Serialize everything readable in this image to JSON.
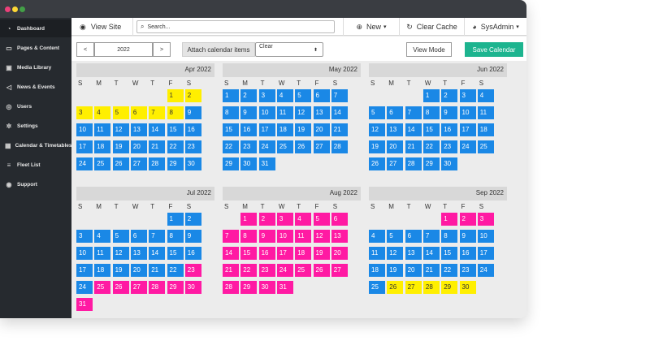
{
  "window": {
    "title_dots": [
      "#ec407a",
      "#fdd835",
      "#43a047"
    ]
  },
  "sidebar": {
    "items": [
      {
        "label": "Dashboard",
        "icon": "dashboard-icon",
        "glyph": "◔",
        "active": true
      },
      {
        "label": "Pages & Content",
        "icon": "monitor-icon",
        "glyph": "▭"
      },
      {
        "label": "Media Library",
        "icon": "image-icon",
        "glyph": "▣"
      },
      {
        "label": "News & Events",
        "icon": "megaphone-icon",
        "glyph": "◁"
      },
      {
        "label": "Users",
        "icon": "users-icon",
        "glyph": "◎"
      },
      {
        "label": "Settings",
        "icon": "gears-icon",
        "glyph": "✲"
      },
      {
        "label": "Calendar & Timetables",
        "icon": "calendar-icon",
        "glyph": "▦"
      },
      {
        "label": "Fleet List",
        "icon": "list-icon",
        "glyph": "≡"
      },
      {
        "label": "Support",
        "icon": "lifebuoy-icon",
        "glyph": "◉"
      }
    ]
  },
  "topbar": {
    "view_site_label": "View Site",
    "view_site_icon": "eye-icon",
    "search_placeholder": "Search...",
    "search_icon": "search-icon",
    "new_label": "New",
    "new_icon": "plus-circle-icon",
    "clear_cache_label": "Clear Cache",
    "clear_cache_icon": "refresh-icon",
    "user_label": "SysAdmin",
    "user_icon": "user-icon"
  },
  "toolbar": {
    "prev_label": "<",
    "year": "2022",
    "next_label": ">",
    "attach_label": "Attach calendar items",
    "select_value": "Clear",
    "view_mode_label": "View Mode",
    "save_label": "Save Calendar"
  },
  "colors": {
    "blue": "#1a88e6",
    "yellow": "#ffef00",
    "pink": "#ff1aa3",
    "accent": "#1db48f"
  },
  "calendar": {
    "weekdays": [
      "S",
      "M",
      "T",
      "W",
      "T",
      "F",
      "S"
    ],
    "months": [
      {
        "label": "Apr 2022",
        "start": 5,
        "days": 30,
        "ranges": [
          [
            "yellow",
            1,
            8
          ],
          [
            "blue",
            9,
            30
          ]
        ]
      },
      {
        "label": "May 2022",
        "start": 0,
        "days": 31,
        "ranges": [
          [
            "blue",
            1,
            31
          ]
        ]
      },
      {
        "label": "Jun 2022",
        "start": 3,
        "days": 30,
        "ranges": [
          [
            "blue",
            1,
            30
          ]
        ]
      },
      {
        "label": "Jul 2022",
        "start": 5,
        "days": 31,
        "ranges": [
          [
            "blue",
            1,
            22
          ],
          [
            "pink",
            23,
            23
          ],
          [
            "blue",
            24,
            24
          ],
          [
            "pink",
            25,
            31
          ]
        ]
      },
      {
        "label": "Aug 2022",
        "start": 1,
        "days": 31,
        "ranges": [
          [
            "pink",
            1,
            31
          ]
        ]
      },
      {
        "label": "Sep 2022",
        "start": 4,
        "days": 30,
        "ranges": [
          [
            "pink",
            1,
            3
          ],
          [
            "blue",
            4,
            25
          ],
          [
            "yellow",
            26,
            30
          ]
        ]
      }
    ]
  }
}
